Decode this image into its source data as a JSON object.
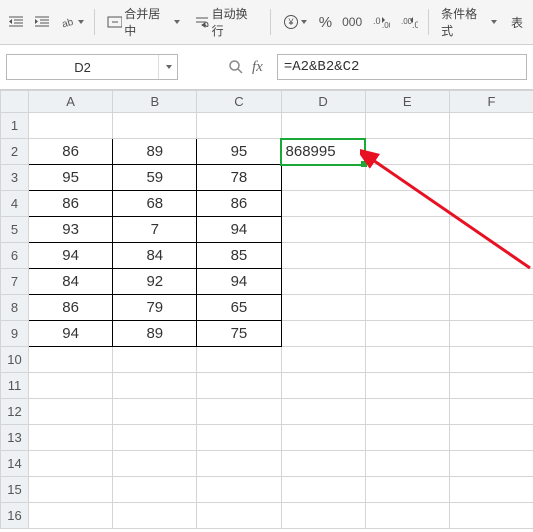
{
  "toolbar": {
    "merge_center_label": "合并居中",
    "wrap_text_label": "自动换行",
    "conditional_format_label": "条件格式",
    "table_format_label": "表"
  },
  "namebox": {
    "value": "D2"
  },
  "formula_bar": {
    "value": "=A2&B2&C2"
  },
  "columns": [
    "A",
    "B",
    "C",
    "D",
    "E",
    "F"
  ],
  "rows": [
    "1",
    "2",
    "3",
    "4",
    "5",
    "6",
    "7",
    "8",
    "9",
    "10",
    "11",
    "12",
    "13",
    "14",
    "15",
    "16"
  ],
  "cells": {
    "A2": "86",
    "B2": "89",
    "C2": "95",
    "D2": "868995",
    "A3": "95",
    "B3": "59",
    "C3": "78",
    "A4": "86",
    "B4": "68",
    "C4": "86",
    "A5": "93",
    "B5": "7",
    "C5": "94",
    "A6": "94",
    "B6": "84",
    "C6": "85",
    "A7": "84",
    "B7": "92",
    "C7": "94",
    "A8": "86",
    "B8": "79",
    "C8": "65",
    "A9": "94",
    "B9": "89",
    "C9": "75"
  },
  "active_cell": "D2"
}
